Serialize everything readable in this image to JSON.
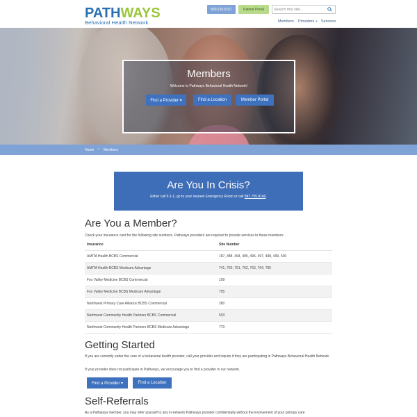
{
  "header": {
    "logo_main_a": "PATH",
    "logo_main_b": "WAYS",
    "logo_sub": "Behavioral Health Network",
    "phone": "800.910.0157",
    "patient_portal": "Patient Portal",
    "search_placeholder": "Search this site...",
    "nav": {
      "members": "Members",
      "providers": "Providers +",
      "services": "Services"
    }
  },
  "hero": {
    "title": "Members",
    "subtitle": "Welcome to Pathways Behavioral Health Network!",
    "buttons": {
      "find_provider": "Find a Provider ▾",
      "find_location": "Find a Location",
      "member_portal": "Member Portal"
    }
  },
  "breadcrumb": {
    "home": "Home",
    "separator": "›",
    "current": "Members"
  },
  "crisis": {
    "title": "Are You In Crisis?",
    "text_before": "Either call 9-1-1, go to your nearest Emergency Room or call ",
    "phone": "847.755.8140",
    "text_after": "."
  },
  "member_section": {
    "heading": "Are You a Member?",
    "intro": "Check your insurance card for the following site numbers. Pathways providers are required to provide services to these members:",
    "table": {
      "headers": [
        "Insurance",
        "Site Number"
      ],
      "rows": [
        [
          "AMITA Health BCBS Commercial",
          "187, 488, 494, 495, 496, 497, 498, 499, 500"
        ],
        [
          "AMITA Health BCBS Medicare Advantage",
          "741, 760, 761, 762, 763, 764, 765"
        ],
        [
          "Fox Valley Medicine BCBS Commercial",
          "199"
        ],
        [
          "Fox Valley Medicine BCBS Medicare Advantage",
          "755"
        ],
        [
          "Northwest Primary Care Alliance BCBS Commercial",
          "280"
        ],
        [
          "Northwest Community Health Partners BCBS Commercial",
          "503"
        ],
        [
          "Northwest Community Health Partners BCBS Medicare Advantage",
          "770"
        ]
      ]
    }
  },
  "getting_started": {
    "heading": "Getting Started",
    "para1": "If you are currently under the care of a behavioral health provider, call your provider and inquire if they are participating in Pathways Behavioral Health Network.",
    "para2": "If your provider does not participate in Pathways, we encourage you to find a provider in our network.",
    "btn_find_provider": "Find a Provider ▾",
    "btn_find_location": "Find a Location"
  },
  "self_referrals": {
    "heading": "Self-Referrals",
    "para": "As a Pathways member, you may refer yourself to any in-network Pathways provider confidentially without the involvement of your primary care"
  },
  "colors": {
    "brand_blue": "#2a6fb1",
    "brand_green": "#9bc63b",
    "button_blue": "#3f72be",
    "crisis_blue": "#3f6eb8",
    "breadcrumb_blue": "#7fa3d6"
  }
}
